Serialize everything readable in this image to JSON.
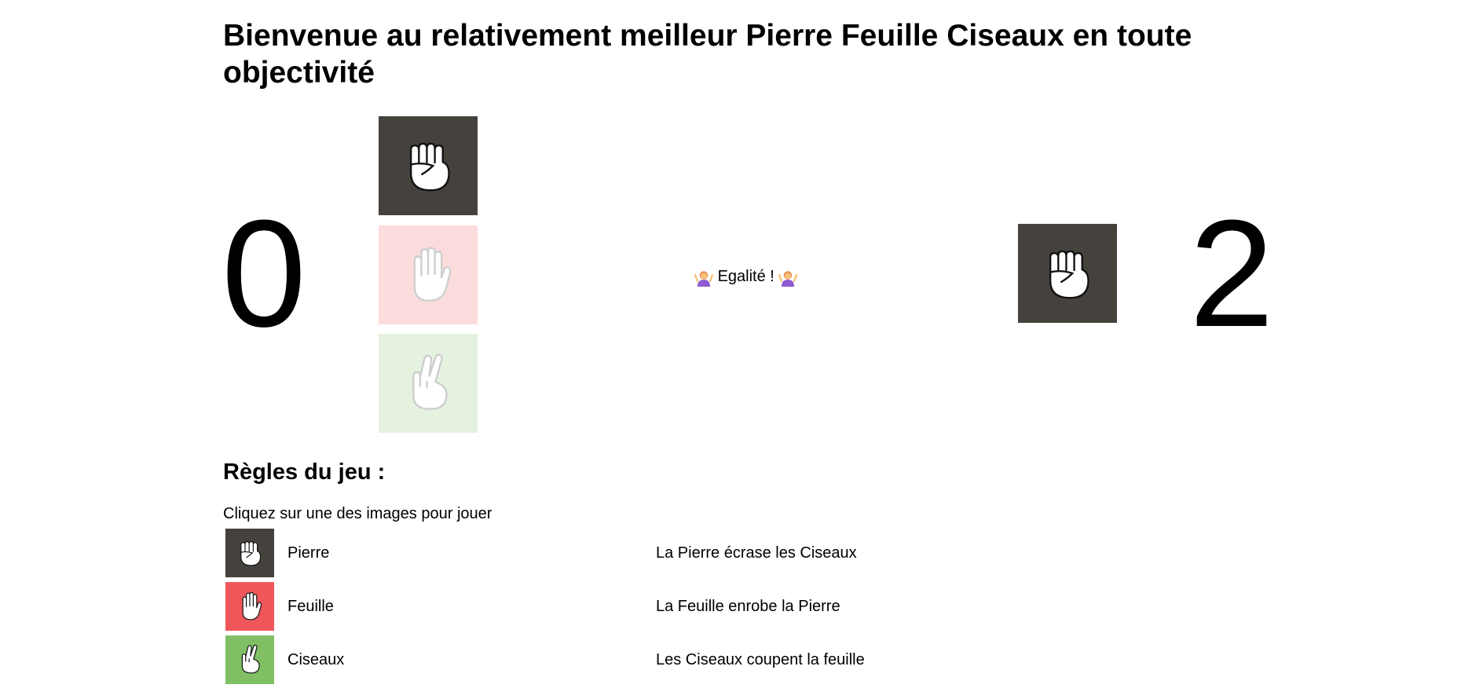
{
  "title": "Bienvenue au relativement meilleur Pierre Feuille Ciseaux en toute objectivité",
  "scores": {
    "player": "0",
    "computer": "2"
  },
  "choices": [
    {
      "name": "Pierre",
      "icon": "fist-hand-icon",
      "color": "#45423d",
      "selected": true
    },
    {
      "name": "Feuille",
      "icon": "raised-hand-icon",
      "color": "#f0575b",
      "selected": false
    },
    {
      "name": "Ciseaux",
      "icon": "victory-hand-icon",
      "color": "#80bf64",
      "selected": false
    }
  ],
  "computer_choice": {
    "name": "Pierre",
    "icon": "fist-hand-icon",
    "color": "#45423d"
  },
  "result": {
    "text": "Egalité !",
    "icon": "person-shrugging-icon"
  },
  "rules": {
    "heading": "Règles du jeu :",
    "instructions": "Cliquez sur une des images pour jouer",
    "items": [
      {
        "name": "Pierre",
        "description": "La Pierre écrase les Ciseaux",
        "icon": "fist-hand-icon",
        "color": "#45423d"
      },
      {
        "name": "Feuille",
        "description": "La Feuille enrobe la Pierre",
        "icon": "raised-hand-icon",
        "color": "#f0575b"
      },
      {
        "name": "Ciseaux",
        "description": "Les Ciseaux coupent la feuille",
        "icon": "victory-hand-icon",
        "color": "#80bf64"
      }
    ]
  }
}
